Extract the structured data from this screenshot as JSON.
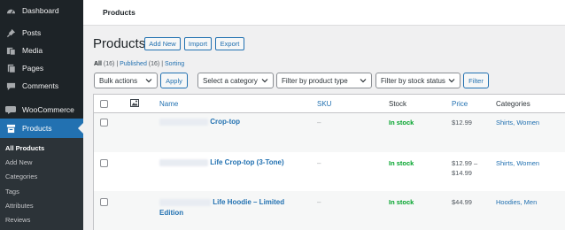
{
  "sidebar": {
    "items": [
      {
        "label": "Dashboard",
        "icon": "dashboard-icon"
      },
      {
        "label": "Posts",
        "icon": "pin-icon"
      },
      {
        "label": "Media",
        "icon": "media-icon"
      },
      {
        "label": "Pages",
        "icon": "pages-icon"
      },
      {
        "label": "Comments",
        "icon": "comment-icon"
      },
      {
        "label": "WooCommerce",
        "icon": "woo-icon"
      },
      {
        "label": "Products",
        "icon": "archive-icon"
      }
    ],
    "submenu": [
      "All Products",
      "Add New",
      "Categories",
      "Tags",
      "Attributes",
      "Reviews"
    ]
  },
  "header": {
    "title": "Products"
  },
  "page": {
    "title": "Products",
    "buttons": [
      "Add New",
      "Import",
      "Export"
    ]
  },
  "views": {
    "all_label": "All",
    "all_count": "(16)",
    "sep1": "|",
    "published_label": "Published",
    "published_count": "(16)",
    "sep2": "|",
    "sorting_label": "Sorting"
  },
  "filters": {
    "bulk_actions": "Bulk actions",
    "apply": "Apply",
    "category": "Select a category",
    "product_type": "Filter by product type",
    "stock_status": "Filter by stock status",
    "filter": "Filter"
  },
  "table": {
    "columns": [
      "Name",
      "SKU",
      "Stock",
      "Price",
      "Categories"
    ],
    "rows": [
      {
        "name_line1": "Crop-top",
        "name_line2": "",
        "sku": "–",
        "stock": "In stock",
        "price_line1": "$12.99",
        "price_line2": "",
        "categories": "Shirts, Women"
      },
      {
        "name_line1": "Life Crop-top (3-Tone)",
        "name_line2": "",
        "sku": "–",
        "stock": "In stock",
        "price_line1": "$12.99 –",
        "price_line2": "$14.99",
        "categories": "Shirts, Women"
      },
      {
        "name_line1": "Life Hoodie – Limited",
        "name_line2": "Edition",
        "sku": "–",
        "stock": "In stock",
        "price_line1": "$44.99",
        "price_line2": "",
        "categories": "Hoodies, Men"
      }
    ]
  },
  "colors": {
    "accent": "#2271b1",
    "sidebar": "#1d2327",
    "in_stock": "#00a32a"
  }
}
